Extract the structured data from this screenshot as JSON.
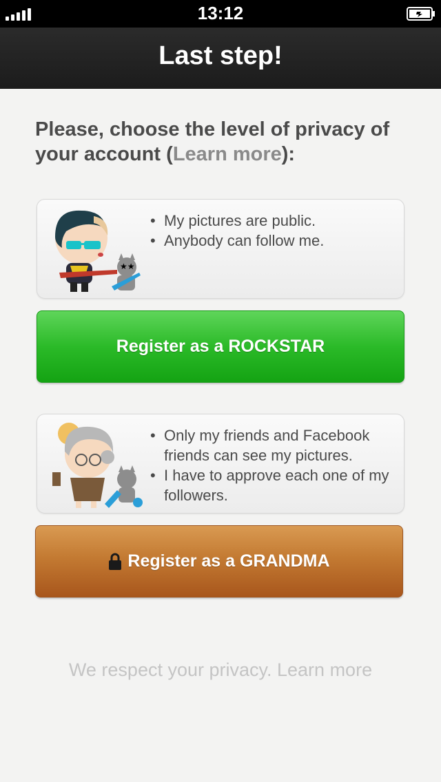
{
  "status_bar": {
    "time": "13:12"
  },
  "nav": {
    "title": "Last step!"
  },
  "intro": {
    "text_before": "Please, choose the level of privacy of your account (",
    "learn_more": "Learn more",
    "text_after": "):"
  },
  "rockstar": {
    "bullets": [
      "My pictures are public.",
      "Anybody can follow me."
    ],
    "button_label": "Register as a ROCKSTAR",
    "color": "#2bba28"
  },
  "grandma": {
    "bullets": [
      "Only my friends and Facebook friends can see my pictures.",
      "I have to approve each one of my followers."
    ],
    "button_label": "Register as a GRANDMA",
    "color": "#c37a32"
  },
  "footer": {
    "text": "We respect your privacy. Learn more"
  }
}
